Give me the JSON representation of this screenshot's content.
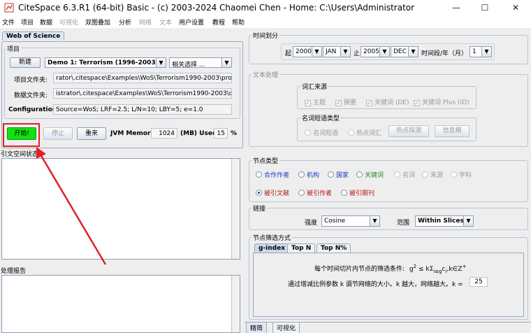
{
  "window": {
    "title": "CiteSpace 6.3.R1 (64-bit) Basic - (c) 2003-2024 Chaomei Chen - Home: C:\\Users\\Administrator",
    "min": "—",
    "max": "☐",
    "close": "✕"
  },
  "menu": [
    {
      "label": "文件",
      "enabled": true
    },
    {
      "label": "项目",
      "enabled": true
    },
    {
      "label": "数据",
      "enabled": true
    },
    {
      "label": "可视化",
      "enabled": false
    },
    {
      "label": "双图叠加",
      "enabled": true
    },
    {
      "label": "分析",
      "enabled": true
    },
    {
      "label": "网络",
      "enabled": false
    },
    {
      "label": "文本",
      "enabled": false
    },
    {
      "label": "用户设置",
      "enabled": true
    },
    {
      "label": "教程",
      "enabled": true
    },
    {
      "label": "帮助",
      "enabled": true
    }
  ],
  "left": {
    "tab": "Web of Science",
    "project": {
      "group_label": "项目",
      "new_button": "新建",
      "project_select": "Demo 1: Terrorism (1996-2003)",
      "related_select": "相关选择 ...",
      "project_dir_label": "项目文件夹:",
      "project_dir": "rator\\.citespace\\Examples\\WoS\\Terrorism1990-2003\\project",
      "data_dir_label": "数据文件夹:",
      "data_dir": "istrator\\.citespace\\Examples\\WoS\\Terrorism1990-2003\\data",
      "config_label": "Configuration:",
      "config_value": "Source=WoS; LRF=2.5; L/N=10; LBY=5; e=1.0"
    },
    "controls": {
      "start": "开始!",
      "stop": "停止",
      "reset": "重来",
      "jvm_label": "JVM Memory",
      "jvm_value": "1024",
      "mb_used_label": "(MB) Used",
      "used_value": "15",
      "percent": "%"
    },
    "citation_status_label": "引文空间状态",
    "report_label": "处理报告"
  },
  "right": {
    "time": {
      "group_label": "时间划分",
      "from_label": "起",
      "from_year": "2000",
      "from_month": "JAN",
      "to_label": "止",
      "to_year": "2005",
      "to_month": "DEC",
      "slice_label": "时间段/年（月）",
      "slice_value": "1"
    },
    "text": {
      "group_label": "文本处理",
      "sources_label": "词汇来源",
      "sources": [
        "主题",
        "摘要",
        "关键词 (DE)",
        "关键词 Plus (ID)"
      ],
      "noun_label": "名词短语类型",
      "noun_types": [
        "名词短语",
        "热点词汇"
      ],
      "burst_button": "热点探测",
      "entropy_button": "信息熵"
    },
    "node_types": {
      "group_label": "节点类型",
      "row1": [
        {
          "label": "合作作者",
          "color": "#1f3fbf",
          "enabled": true
        },
        {
          "label": "机构",
          "color": "#1f3fbf",
          "enabled": true
        },
        {
          "label": "国家",
          "color": "#1f3fbf",
          "enabled": true
        },
        {
          "label": "关键词",
          "color": "#2a8a2a",
          "enabled": true
        },
        {
          "label": "名词",
          "color": "#9a9a9a",
          "enabled": false
        },
        {
          "label": "来源",
          "color": "#9a9a9a",
          "enabled": false
        },
        {
          "label": "学科",
          "color": "#9a9a9a",
          "enabled": false
        }
      ],
      "row2": [
        {
          "label": "被引文献",
          "color": "#b01818",
          "selected": true
        },
        {
          "label": "被引作者",
          "color": "#b01818",
          "selected": false
        },
        {
          "label": "被引期刊",
          "color": "#b01818",
          "selected": false
        }
      ]
    },
    "links": {
      "group_label": "链接",
      "strength_label": "强度",
      "strength_value": "Cosine",
      "scope_label": "范围",
      "scope_value": "Within Slices"
    },
    "selection": {
      "group_label": "节点筛选方式",
      "tabs": [
        "g-index",
        "Top N",
        "Top N%"
      ],
      "active_tab": "g-index",
      "criteria_label": "每个时间切片内节点的筛选条件:",
      "formula_main": "g",
      "formula_sup": "2",
      "formula_mid": " ≤ k",
      "formula_sum": "Σ",
      "formula_sum_sub": "i≤g",
      "formula_c": "c",
      "formula_c_sub": "i",
      "formula_end": ",k∈Z",
      "formula_end_sup": "+",
      "scale_label": "通过增减比例参数 k 调节网络的大小。k 越大，网络越大。k =",
      "k_value": "25"
    },
    "bottom_tabs": [
      "精简",
      "可视化"
    ]
  },
  "annotation": {
    "color": "#e21f26"
  }
}
